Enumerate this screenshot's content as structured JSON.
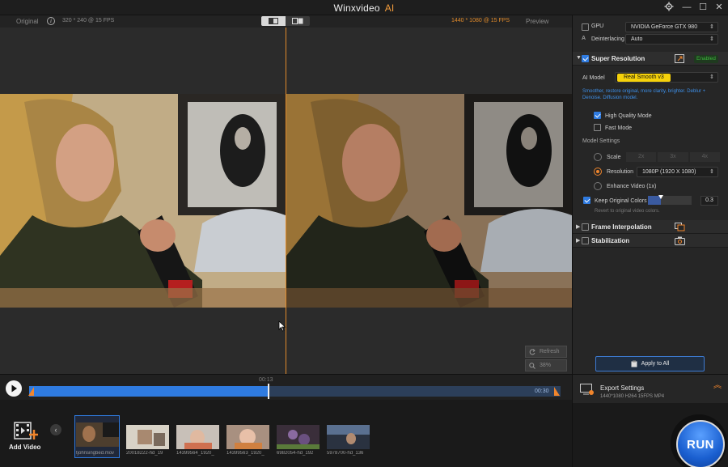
{
  "app": {
    "title": "Winxvideo",
    "title_badge": "AI"
  },
  "window": {
    "settings_icon": "gear-icon",
    "min_symbol": "—",
    "max_symbol": "☐",
    "close_symbol": "✕"
  },
  "preview": {
    "left_label": "Original",
    "info_symbol": "i",
    "left_meta": "320 * 240 @ 15 FPS",
    "right_meta": "1440 * 1080 @ 15 FPS",
    "right_label": "Preview",
    "refresh_label": "Refresh",
    "zoom_value": "38%"
  },
  "timeline": {
    "current_time": "00:13",
    "end_time": "00:30",
    "progress": 0.45
  },
  "panel": {
    "gpu_label": "GPU",
    "gpu_value": "NVIDIA GeForce GTX 980",
    "deinterlacing_label": "Deinterlacing",
    "deinterlacing_value": "Auto",
    "super_resolution": {
      "title": "Super Resolution",
      "status": "Enabled",
      "ai_model_label": "AI Model",
      "ai_model_value": "Real Smooth v3",
      "description": "Smoother, restore original, more clarity, brighter. Deblur + Denoise. Diffusion model.",
      "high_quality_label": "High Quality Mode",
      "fast_mode_label": "Fast Mode",
      "model_settings_label": "Model Settings",
      "scale_label": "Scale",
      "scale_options": [
        "2x",
        "3x",
        "4x"
      ],
      "resolution_label": "Resolution",
      "resolution_value": "1080P (1920 X 1080)",
      "enhance_label": "Enhance Video (1x)",
      "keep_colors_label": "Keep Original Colors",
      "keep_colors_value": "0.3",
      "keep_colors_level": 0.3,
      "keep_colors_hint": "Revert to original video colors."
    },
    "frame_interpolation_label": "Frame Interpolation",
    "stabilization_label": "Stabilization",
    "apply_all_label": "Apply to All"
  },
  "export": {
    "title": "Export Settings",
    "details": "1440*1080  H264  15FPS  MP4"
  },
  "bottom": {
    "add_video_label": "Add Video",
    "run_label": "RUN",
    "thumbnails": [
      {
        "caption": "tjohnsingbed.mov"
      },
      {
        "caption": "20018222-hd_19"
      },
      {
        "caption": "14399564_1920_"
      },
      {
        "caption": "14399563_1920_"
      },
      {
        "caption": "6982054-hd_192"
      },
      {
        "caption": "5978700-hd_136"
      }
    ]
  },
  "colors": {
    "accent": "#f0852c",
    "blue": "#2f7be0",
    "enabled": "#3cb93c"
  }
}
